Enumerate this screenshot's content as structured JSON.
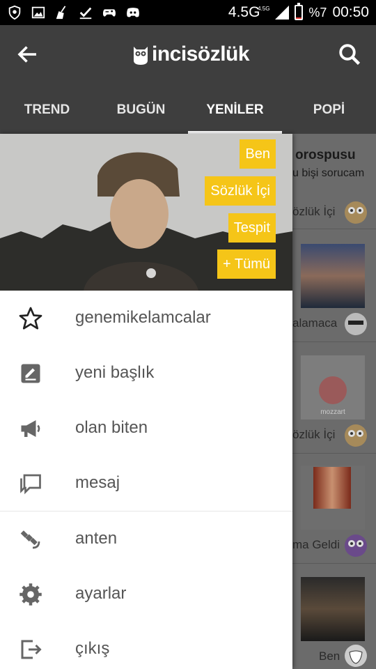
{
  "status_bar": {
    "network": "4.5G",
    "network_sup": "4.5G",
    "battery_percent": "%7",
    "battery_level": 0.07,
    "time": "00:50",
    "left_icons": [
      "shield-icon",
      "image-icon",
      "broom-icon",
      "checkmark-icon",
      "gamepad-icon",
      "discord-icon"
    ]
  },
  "appbar": {
    "logo_text": "incisözlük",
    "tabs": [
      {
        "label": "TREND"
      },
      {
        "label": "BUGÜN"
      },
      {
        "label": "YENİLER"
      },
      {
        "label": "POPİ"
      }
    ],
    "active_tab": 2,
    "accent": "#f5c518"
  },
  "drawer": {
    "header_chips": [
      {
        "label": "Ben"
      },
      {
        "label": "Sözlük İçi"
      },
      {
        "label": "Tespit"
      },
      {
        "label": "+ Tümü"
      }
    ],
    "menu": [
      {
        "label": "genemikelamcalar",
        "icon": "star-icon"
      },
      {
        "label": "yeni başlık",
        "icon": "edit-icon"
      },
      {
        "label": "olan biten",
        "icon": "megaphone-icon"
      },
      {
        "label": "mesaj",
        "icon": "chat-icon"
      },
      {
        "label": "anten",
        "icon": "satellite-icon"
      },
      {
        "label": "ayarlar",
        "icon": "gear-icon"
      },
      {
        "label": "çıkış",
        "icon": "logout-icon"
      }
    ]
  },
  "feed": {
    "title": "orospusu",
    "subtitle": "u bişi sorucam",
    "meta": [
      "özlük İçi",
      "alamaca",
      "özlük İçi",
      "ma Geldi",
      "Ben"
    ],
    "thumb_caption": "mozzart"
  }
}
